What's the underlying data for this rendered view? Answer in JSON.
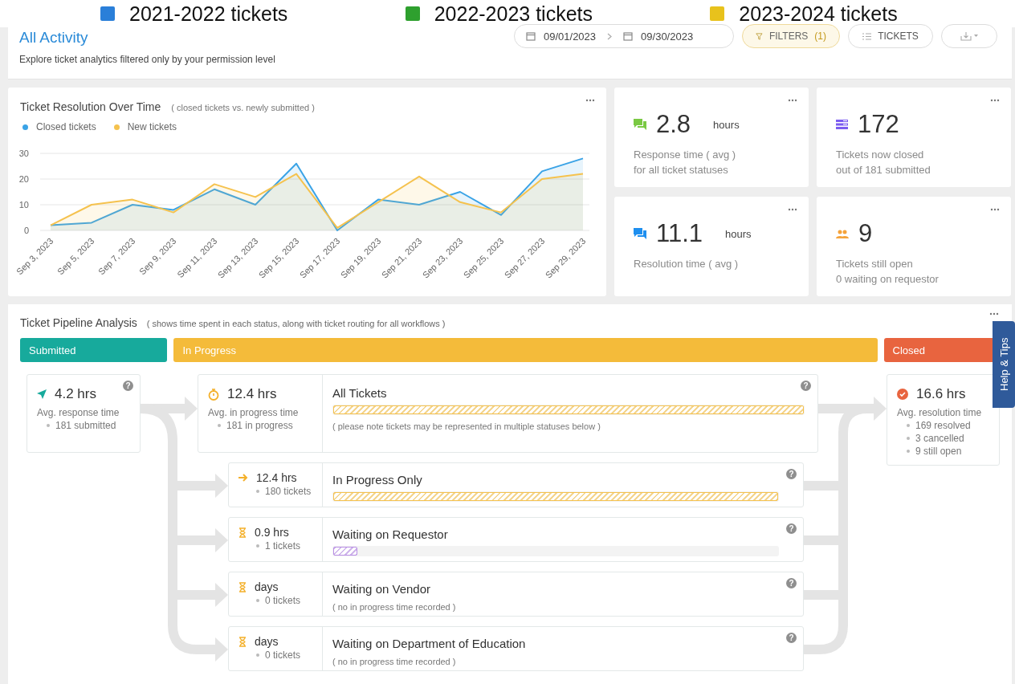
{
  "legend_overlay": [
    {
      "label": "2021-2022 tickets",
      "color": "#2a7fd9"
    },
    {
      "label": "2022-2023 tickets",
      "color": "#2ea02e"
    },
    {
      "label": "2023-2024 tickets",
      "color": "#e8c21c"
    }
  ],
  "header": {
    "title": "All Activity",
    "subtitle": "Explore ticket analytics filtered only by your permission level",
    "date_from": "09/01/2023",
    "date_to": "09/30/2023",
    "filters_label": "FILTERS",
    "filters_count": "(1)",
    "tickets_label": "TICKETS"
  },
  "resolution_chart": {
    "title": "Ticket Resolution Over Time",
    "subtitle": "( closed tickets vs. newly submitted )",
    "chart_data": {
      "type": "area",
      "categories": [
        "Sep 3, 2023",
        "Sep 5, 2023",
        "Sep 7, 2023",
        "Sep 9, 2023",
        "Sep 11, 2023",
        "Sep 13, 2023",
        "Sep 15, 2023",
        "Sep 17, 2023",
        "Sep 19, 2023",
        "Sep 21, 2023",
        "Sep 23, 2023",
        "Sep 25, 2023",
        "Sep 27, 2023",
        "Sep 29, 2023"
      ],
      "series": [
        {
          "name": "Closed tickets",
          "color": "#3aa3e6",
          "values": [
            2,
            3,
            10,
            8,
            16,
            10,
            26,
            0,
            12,
            10,
            15,
            6,
            23,
            28
          ]
        },
        {
          "name": "New tickets",
          "color": "#f5c24e",
          "values": [
            2,
            10,
            12,
            7,
            18,
            13,
            22,
            1,
            11,
            21,
            11,
            7,
            20,
            22
          ]
        }
      ],
      "ylim": [
        0,
        30
      ],
      "yticks": [
        0,
        10,
        20,
        30
      ]
    }
  },
  "stats": [
    {
      "kind": "response",
      "value": "2.8",
      "unit": "hours",
      "lines": [
        "Response time ( avg )",
        "for all ticket statuses"
      ]
    },
    {
      "kind": "closed",
      "value": "172",
      "lines": [
        "Tickets now closed",
        "out of 181 submitted"
      ]
    },
    {
      "kind": "resolution",
      "value": "11.1",
      "unit": "hours",
      "lines": [
        "Resolution time ( avg )"
      ]
    },
    {
      "kind": "open",
      "value": "9",
      "lines": [
        "Tickets still open",
        "0 waiting on requestor"
      ]
    }
  ],
  "pipeline": {
    "title": "Ticket Pipeline Analysis",
    "subtitle": "( shows time spent in each status, along with ticket routing for all workflows )",
    "stages": [
      {
        "label": "Submitted",
        "color": "#17aa9c"
      },
      {
        "label": "In Progress",
        "color": "#f4bb3a"
      },
      {
        "label": "Closed",
        "color": "#e8643f"
      }
    ],
    "submitted": {
      "value": "4.2 hrs",
      "label": "Avg. response time",
      "bullets": [
        "181 submitted"
      ],
      "help": "?"
    },
    "all_tickets": {
      "value": "12.4 hrs",
      "label": "Avg. in progress time",
      "bullets": [
        "181 in progress"
      ],
      "title": "All Tickets",
      "level": 1,
      "color": "#f5c24e",
      "note": "( please note tickets may be represented in multiple statuses below )",
      "help": "?"
    },
    "rows": [
      {
        "kind": "arrow",
        "value": "12.4 hrs",
        "count": "180 tickets",
        "title": "In Progress Only",
        "level": 1,
        "color": "#f5c24e",
        "help": "?"
      },
      {
        "kind": "hourglass",
        "value": "0.9 hrs",
        "count": "1 tickets",
        "title": "Waiting on Requestor",
        "level": 0.055,
        "color": "#b98ee6",
        "help": "?"
      },
      {
        "kind": "hourglass",
        "value": "days",
        "count": "0 tickets",
        "title": "Waiting on Vendor",
        "note": "( no in progress time recorded )",
        "help": "?"
      },
      {
        "kind": "hourglass",
        "value": "days",
        "count": "0 tickets",
        "title": "Waiting on Department of Education",
        "note": "( no in progress time recorded )",
        "help": "?"
      }
    ],
    "closed": {
      "value": "16.6 hrs",
      "label": "Avg. resolution time",
      "bullets": [
        "169 resolved",
        "3 cancelled",
        "9 still open"
      ]
    }
  },
  "help_tab": {
    "label": "Help & Tips"
  }
}
